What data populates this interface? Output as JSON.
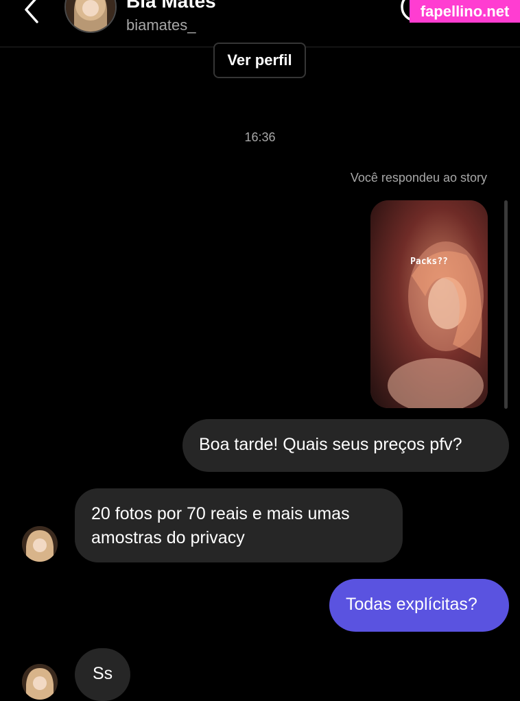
{
  "header": {
    "display_name": "Bia Mates",
    "username": "biamates_",
    "watermark": "fapellino.net",
    "icons": {
      "back": "chevron-left-icon",
      "call": "phone-icon",
      "avatar": "profile-avatar"
    }
  },
  "profile_button": {
    "label": "Ver perfil"
  },
  "conversation": {
    "timestamp": "16:36",
    "story_reply_caption": "Você respondeu ao story",
    "story_sticker_text": "Packs??",
    "messages": [
      {
        "from": "me",
        "text": "Boa tarde! Quais seus preços pfv?"
      },
      {
        "from": "them",
        "text": "20 fotos por 70 reais e mais umas amostras do privacy"
      },
      {
        "from": "me",
        "text": "Todas explícitas?"
      },
      {
        "from": "them",
        "text": "Ss"
      }
    ]
  },
  "colors": {
    "background": "#000000",
    "incoming_bubble": "#262626",
    "outgoing_gray_bubble": "#262626",
    "outgoing_accent_bubble": "#5a53e0",
    "secondary_text": "#a8a8a8",
    "watermark_bg": "#ff3dd1"
  }
}
